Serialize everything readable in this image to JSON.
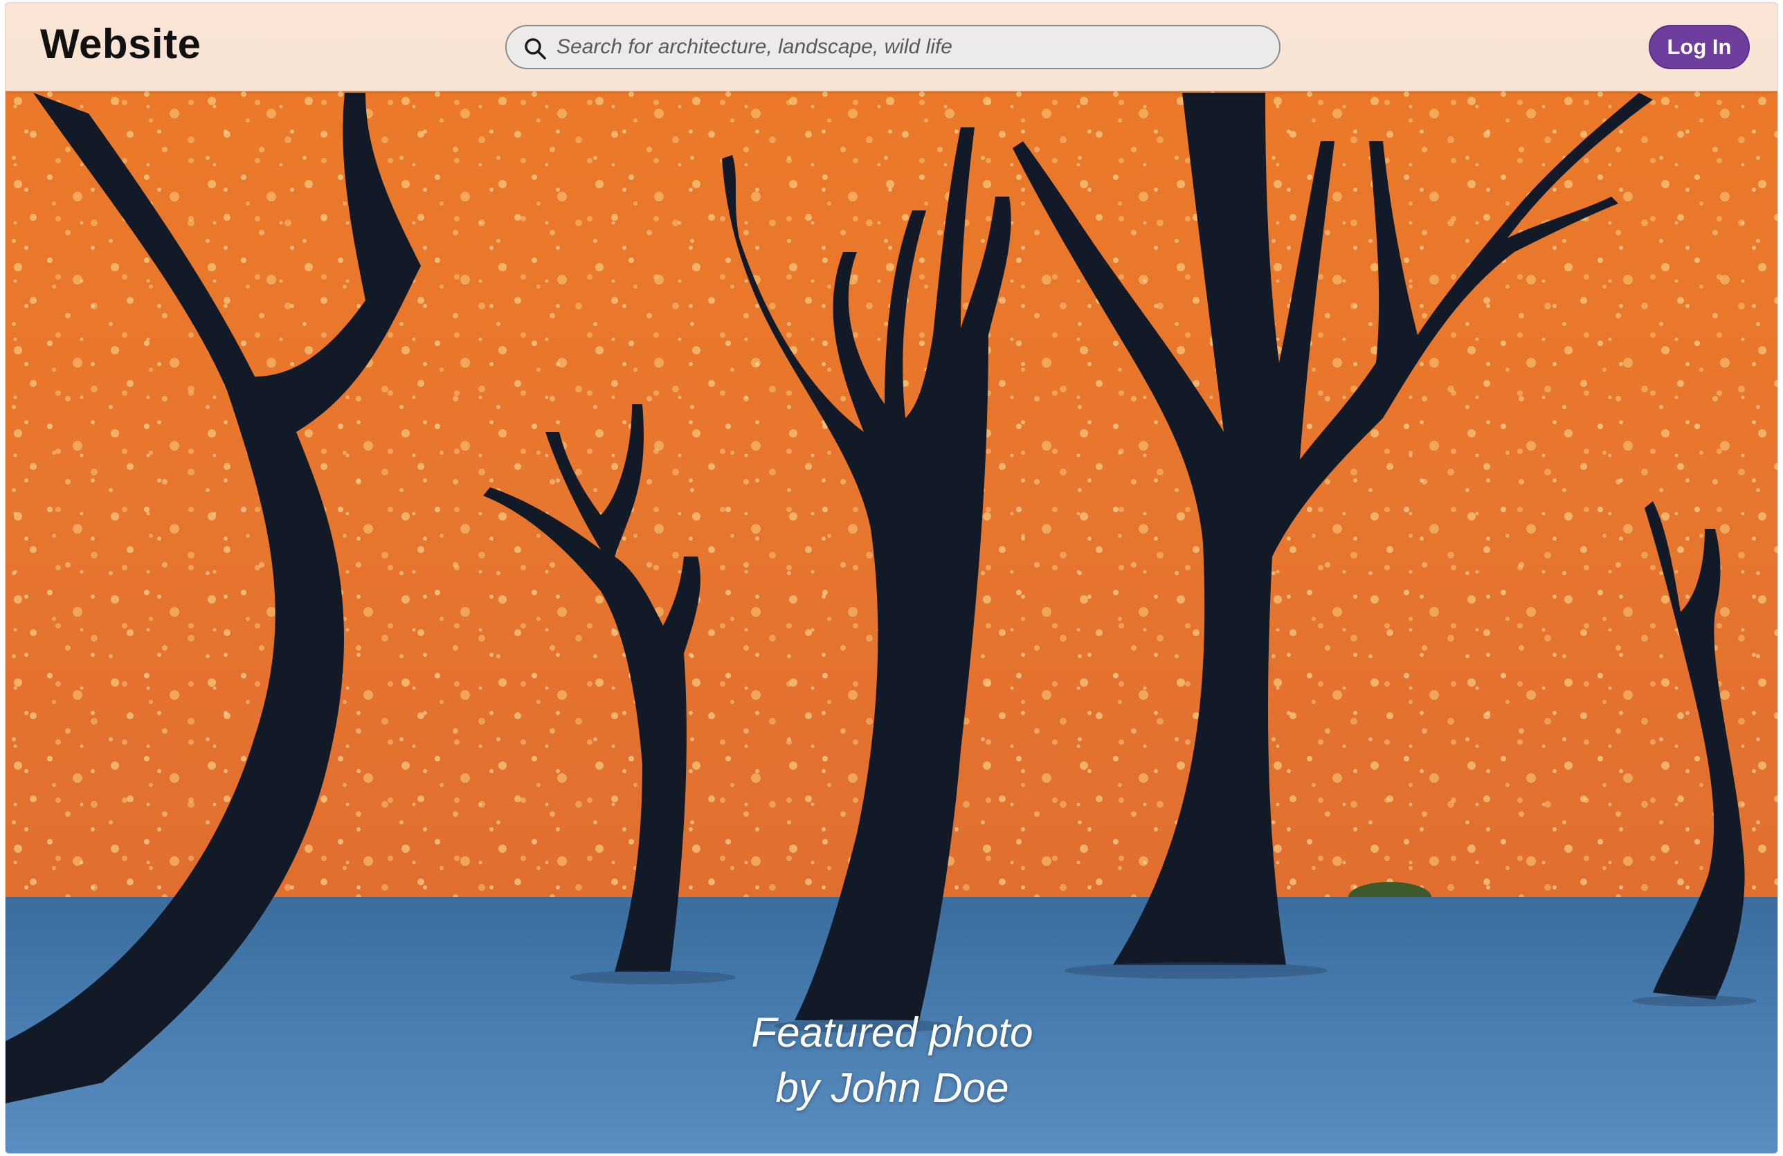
{
  "header": {
    "brand": "Website",
    "search": {
      "placeholder": "Search for architecture, landscape, wild life",
      "value": "",
      "icon": "search-icon"
    },
    "login_label": "Log In"
  },
  "hero": {
    "caption_line1": "Featured photo",
    "caption_line2": "by John Doe"
  },
  "colors": {
    "accent": "#6d3e9e",
    "dune_orange": "#e9772c",
    "pan_blue": "#3a6b9c",
    "tree_silhouette": "#121a28"
  }
}
